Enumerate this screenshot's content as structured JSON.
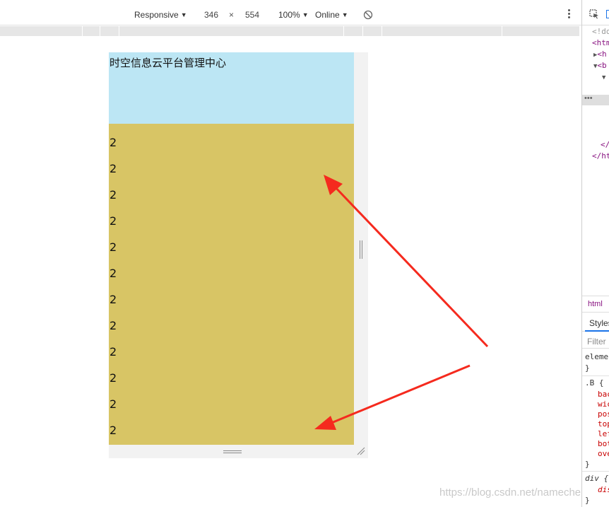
{
  "toolbar": {
    "device_mode": "Responsive",
    "width": "346",
    "times": "×",
    "height": "554",
    "zoom": "100%",
    "throttle": "Online"
  },
  "page": {
    "header_text": "时空信息云平台管理中心",
    "items": [
      "2",
      "2",
      "2",
      "2",
      "2",
      "2",
      "2",
      "2",
      "2",
      "2",
      "2",
      "2"
    ],
    "header_color": "#bce6f4",
    "body_color": "#d8c565"
  },
  "annotation": {
    "arrow_color": "#f52a1e"
  },
  "watermark": "https://blog.csdn.net/namechenfl",
  "devtools": {
    "elements": [
      {
        "text": "<!do",
        "cls": "gray"
      },
      {
        "text": "<htm",
        "cls": "tag"
      },
      {
        "text": "<h",
        "cls": "tag"
      },
      {
        "text": "<b",
        "cls": "tag"
      },
      {
        "text": "</",
        "cls": "tag"
      },
      {
        "text": "</ht",
        "cls": "tag"
      }
    ],
    "ellipsis": "•••",
    "breadcrumb": "html",
    "styles_tab": "Styles",
    "filter_placeholder": "Filter",
    "rules": {
      "element_selector": "eleme",
      "brace_close": "}",
      "b_selector": ".B {",
      "b_props": [
        "bac",
        "wic",
        "pos",
        "top",
        "lef",
        "bot",
        "ove"
      ],
      "div_selector": "div {",
      "div_props": [
        "dis"
      ]
    }
  }
}
